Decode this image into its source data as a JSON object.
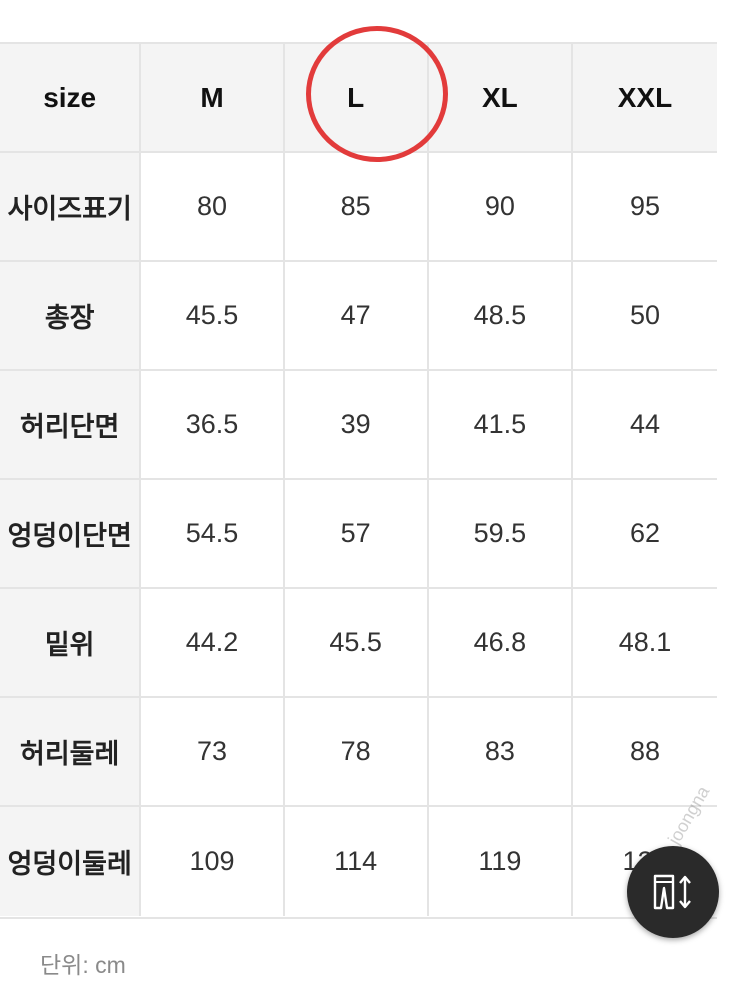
{
  "table": {
    "header": [
      "size",
      "M",
      "L",
      "XL",
      "XXL"
    ],
    "rows": [
      {
        "label": "사이즈표기",
        "values": [
          "80",
          "85",
          "90",
          "95"
        ]
      },
      {
        "label": "총장",
        "values": [
          "45.5",
          "47",
          "48.5",
          "50"
        ]
      },
      {
        "label": "허리단면",
        "values": [
          "36.5",
          "39",
          "41.5",
          "44"
        ]
      },
      {
        "label": "엉덩이단면",
        "values": [
          "54.5",
          "57",
          "59.5",
          "62"
        ]
      },
      {
        "label": "밑위",
        "values": [
          "44.2",
          "45.5",
          "46.8",
          "48.1"
        ]
      },
      {
        "label": "허리둘레",
        "values": [
          "73",
          "78",
          "83",
          "88"
        ]
      },
      {
        "label": "엉덩이둘레",
        "values": [
          "109",
          "114",
          "119",
          "124"
        ]
      }
    ]
  },
  "highlight": {
    "column": "L",
    "color": "#e23b3b"
  },
  "unit_note": "단위: cm",
  "fab": {
    "icon": "pants-measure-icon"
  },
  "watermark": "joongna"
}
